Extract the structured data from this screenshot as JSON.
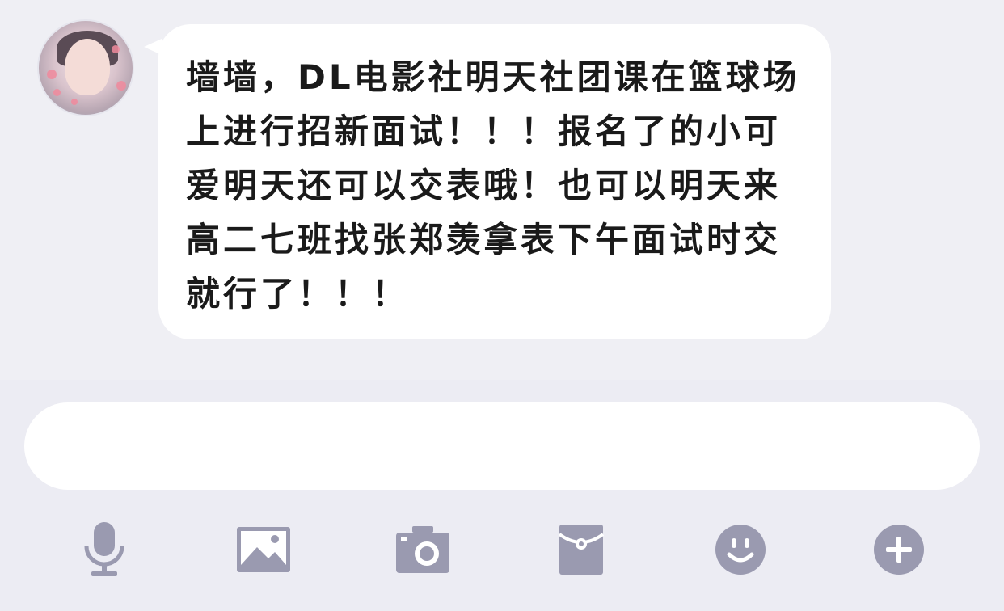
{
  "chat": {
    "message": "墙墙，DL电影社明天社团课在篮球场上进行招新面试！！！报名了的小可爱明天还可以交表哦！也可以明天来高二七班找张郑羡拿表下午面试时交就行了！！！"
  },
  "input": {
    "value": "",
    "placeholder": ""
  },
  "toolbar": {
    "icons": [
      "microphone-icon",
      "image-icon",
      "camera-icon",
      "red-packet-icon",
      "emoji-icon",
      "plus-icon"
    ],
    "icon_color": "#9a9ab0"
  },
  "colors": {
    "background": "#efeff4",
    "bubble": "#ffffff",
    "text": "#1a1a1a"
  }
}
